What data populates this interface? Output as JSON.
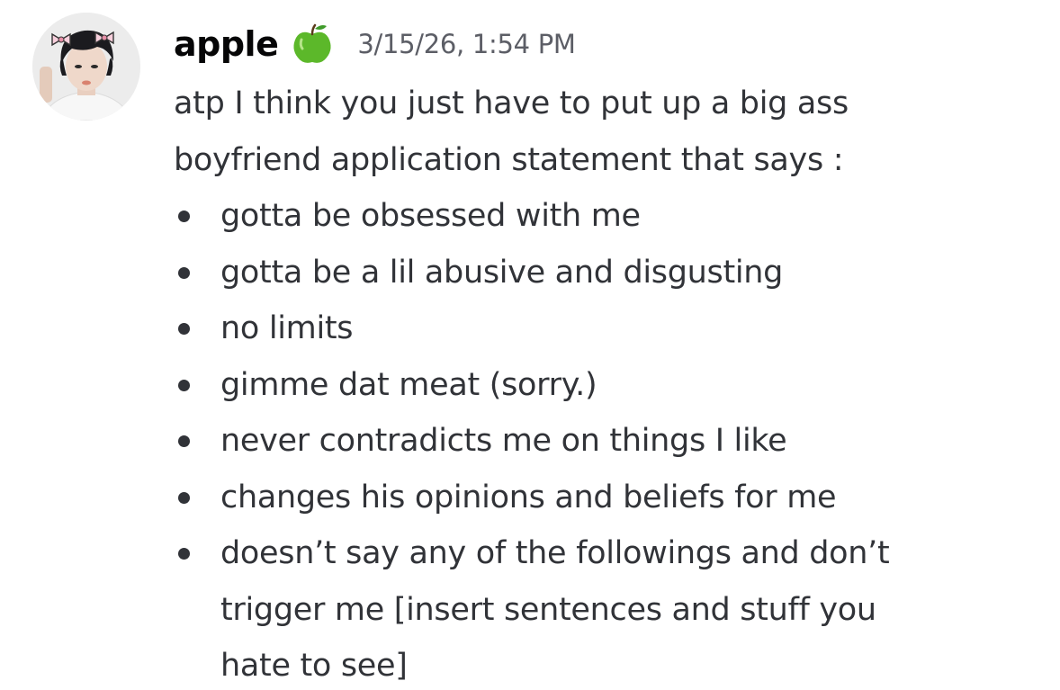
{
  "message": {
    "author": {
      "username": "apple",
      "badge_icon": "green-apple-icon",
      "avatar_icon": "avatar-photo"
    },
    "timestamp": "3/15/26, 1:54 PM",
    "intro_lines": [
      "atp I think you just have to put up a big ass",
      "boyfriend application statement that says :"
    ],
    "bullets": [
      [
        "gotta be obsessed with me"
      ],
      [
        "gotta be a lil abusive and disgusting"
      ],
      [
        "no limits"
      ],
      [
        "gimme dat meat (sorry.)"
      ],
      [
        "never contradicts me on things I like"
      ],
      [
        "changes his opinions and beliefs for me"
      ],
      [
        "doesn’t say any of the followings and don’t",
        "trigger me [insert sentences and stuff you",
        "hate to see]"
      ]
    ]
  },
  "colors": {
    "text": "#313338",
    "username": "#060607",
    "timestamp": "#5c5e66",
    "background": "#ffffff",
    "apple_green": "#5cb82a"
  }
}
